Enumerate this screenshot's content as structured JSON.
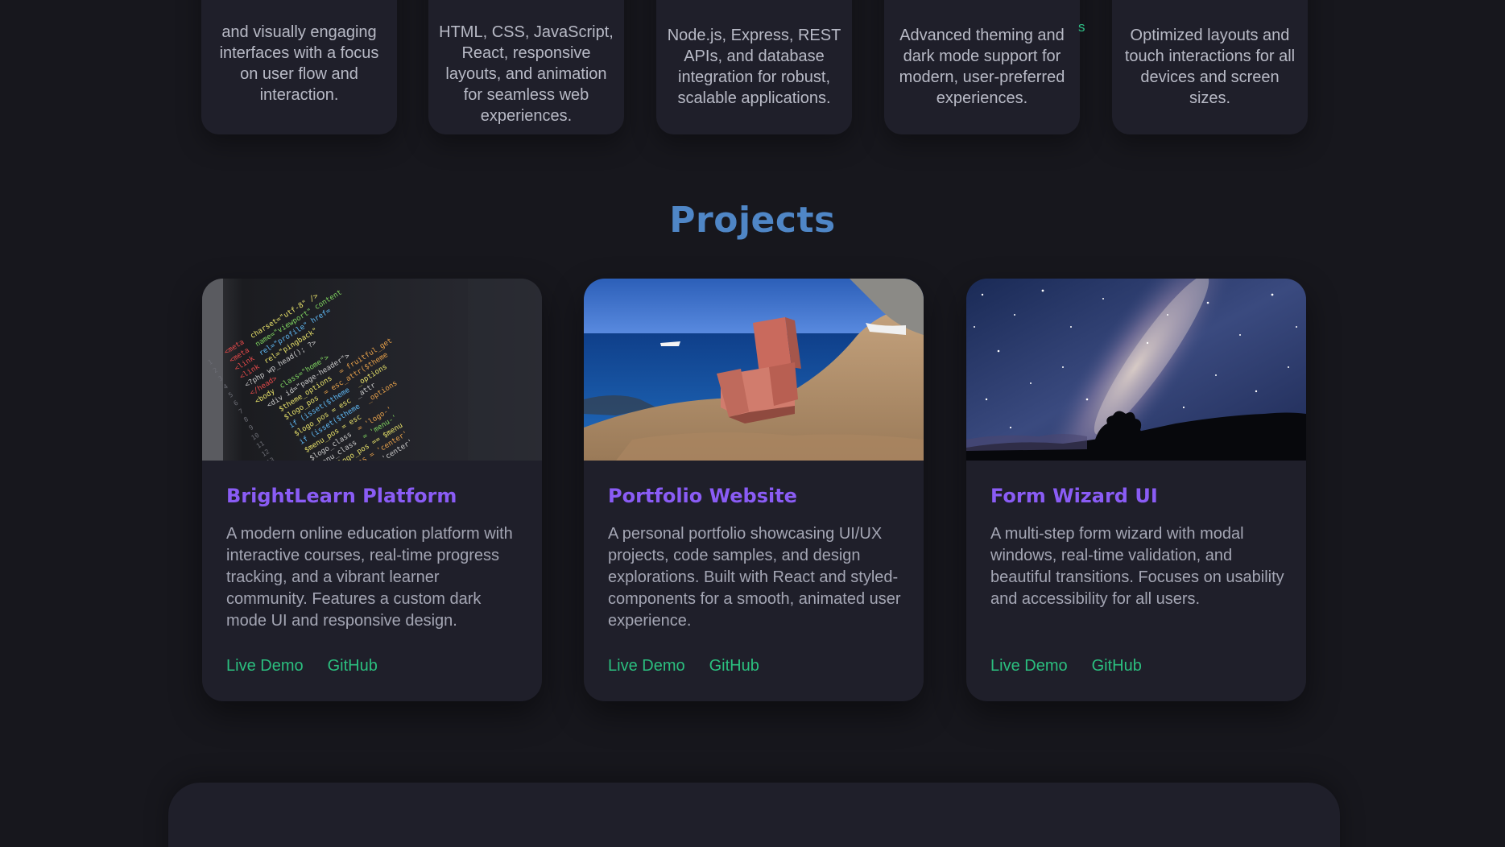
{
  "skills": [
    {
      "description": "and visually engaging interfaces with a focus on user flow and interaction."
    },
    {
      "description": "HTML, CSS, JavaScript, React, responsive layouts, and animation for seamless web experiences."
    },
    {
      "description": "Node.js, Express, REST APIs, and database integration for robust, scalable applications."
    },
    {
      "description": "Advanced theming and dark mode support for modern, user-preferred experiences."
    },
    {
      "description": "Optimized layouts and touch interactions for all devices and screen sizes."
    }
  ],
  "stray_text": "s",
  "projects_section": {
    "title": "Projects",
    "projects": [
      {
        "title": "BrightLearn Platform",
        "description": "A modern online education platform with interactive courses, real-time progress tracking, and a vibrant learner community. Features a custom dark mode UI and responsive design.",
        "image": "code-editor-screenshot",
        "live_demo_label": "Live Demo",
        "github_label": "GitHub"
      },
      {
        "title": "Portfolio Website",
        "description": "A personal portfolio showcasing UI/UX projects, code samples, and design explorations. Built with React and styled-components for a smooth, animated user experience.",
        "image": "armchair-on-seaside-cliff",
        "live_demo_label": "Live Demo",
        "github_label": "GitHub"
      },
      {
        "title": "Form Wizard UI",
        "description": "A multi-step form wizard with modal windows, real-time validation, and beautiful transitions. Focuses on usability and accessibility for all users.",
        "image": "milky-way-night-sky",
        "live_demo_label": "Live Demo",
        "github_label": "GitHub"
      }
    ]
  },
  "colors": {
    "background": "#17171d",
    "card": "#1f1f2a",
    "section_title": "#4f86c6",
    "project_title": "#8a5cf5",
    "link": "#2bbf7f",
    "body_text": "#a4a6b4"
  }
}
